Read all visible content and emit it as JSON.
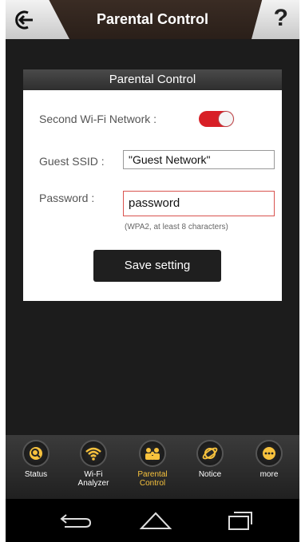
{
  "header": {
    "title": "Parental Control",
    "left_icon": "exit-icon",
    "right_icon": "help-icon",
    "help_glyph": "?"
  },
  "panel": {
    "title": "Parental Control",
    "second_wifi_label": "Second Wi-Fi Network :",
    "second_wifi_on": true,
    "ssid_label": "Guest SSID :",
    "ssid_value": "\"Guest Network\"",
    "password_label": "Password :",
    "password_value": "password",
    "password_hint": "(WPA2, at least 8 characters)",
    "save_label": "Save setting"
  },
  "nav": {
    "items": [
      {
        "label": "Status",
        "icon": "status-icon"
      },
      {
        "label": "Wi-Fi Analyzer",
        "icon": "wifi-analyzer-icon"
      },
      {
        "label": "Parental Control",
        "icon": "parental-control-icon",
        "active": true
      },
      {
        "label": "Notice",
        "icon": "notice-icon"
      },
      {
        "label": "more",
        "icon": "more-icon"
      }
    ]
  },
  "colors": {
    "accent": "#f7c23d",
    "toggle_on": "#d81f26",
    "password_border": "#d9534f"
  }
}
